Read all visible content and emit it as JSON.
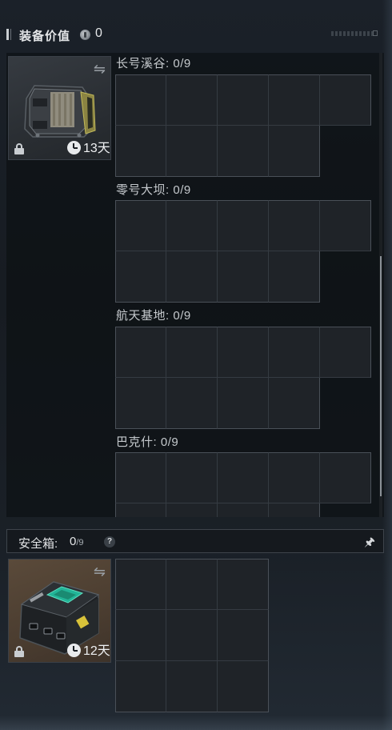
{
  "header": {
    "title": "装备价值",
    "value": "0",
    "icon": "coin-icon"
  },
  "stash_card": {
    "days": "13天",
    "icons": [
      "swap-icon",
      "lock-icon",
      "clock-icon"
    ],
    "background": "#2a2e33"
  },
  "maps": [
    {
      "name": "长号溪谷",
      "capacity": ": 0/9"
    },
    {
      "name": "零号大坝",
      "capacity": ": 0/9"
    },
    {
      "name": "航天基地",
      "capacity": ": 0/9"
    },
    {
      "name": "巴克什",
      "capacity": ": 0/9"
    }
  ],
  "safe_box": {
    "label": "安全箱:",
    "count": "0",
    "capacity": "/9",
    "help": "?",
    "pin_icon": "pin-icon",
    "days": "12天",
    "background": "#4b3d30"
  },
  "colors": {
    "background": "#1a1f25",
    "cell": "#1f2328",
    "accent_teal": "#22b497"
  }
}
